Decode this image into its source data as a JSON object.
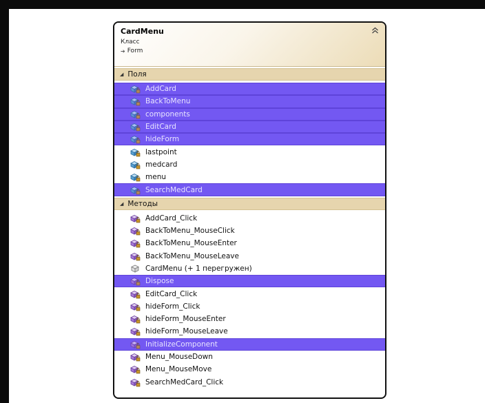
{
  "class_box": {
    "title": "CardMenu",
    "kind": "Класс",
    "base": "Form",
    "fields_section": {
      "label": "Поля",
      "items": [
        {
          "label": "AddCard",
          "icon": "field-icon",
          "selected": true
        },
        {
          "label": "BackToMenu",
          "icon": "field-icon",
          "selected": true
        },
        {
          "label": "components",
          "icon": "field-icon",
          "selected": true
        },
        {
          "label": "EditCard",
          "icon": "field-icon",
          "selected": true
        },
        {
          "label": "hideForm",
          "icon": "field-icon",
          "selected": true
        },
        {
          "label": "lastpoint",
          "icon": "field-icon",
          "selected": false
        },
        {
          "label": "medcard",
          "icon": "field-icon",
          "selected": false
        },
        {
          "label": "menu",
          "icon": "field-icon",
          "selected": false
        },
        {
          "label": "SearchMedCard",
          "icon": "field-icon",
          "selected": true
        }
      ]
    },
    "methods_section": {
      "label": "Методы",
      "items": [
        {
          "label": "AddCard_Click",
          "icon": "method-icon",
          "selected": false
        },
        {
          "label": "BackToMenu_MouseClick",
          "icon": "method-icon",
          "selected": false
        },
        {
          "label": "BackToMenu_MouseEnter",
          "icon": "method-icon",
          "selected": false
        },
        {
          "label": "BackToMenu_MouseLeave",
          "icon": "method-icon",
          "selected": false
        },
        {
          "label": "CardMenu (+ 1 перегружен)",
          "icon": "constructor-icon",
          "selected": false
        },
        {
          "label": "Dispose",
          "icon": "method-icon",
          "selected": true
        },
        {
          "label": "EditCard_Click",
          "icon": "method-icon",
          "selected": false
        },
        {
          "label": "hideForm_Click",
          "icon": "method-icon",
          "selected": false
        },
        {
          "label": "hideForm_MouseEnter",
          "icon": "method-icon",
          "selected": false
        },
        {
          "label": "hideForm_MouseLeave",
          "icon": "method-icon",
          "selected": false
        },
        {
          "label": "InitializeComponent",
          "icon": "method-icon",
          "selected": true
        },
        {
          "label": "Menu_MouseDown",
          "icon": "method-icon",
          "selected": false
        },
        {
          "label": "Menu_MouseMove",
          "icon": "method-icon",
          "selected": false
        },
        {
          "label": "SearchMedCard_Click",
          "icon": "method-icon",
          "selected": false
        }
      ]
    }
  },
  "colors": {
    "selection": "#7358f2",
    "section_header": "#e6d5ae",
    "field_icon": "#5aa0d0",
    "method_icon": "#a77ad6",
    "lock_icon": "#c8962a"
  }
}
